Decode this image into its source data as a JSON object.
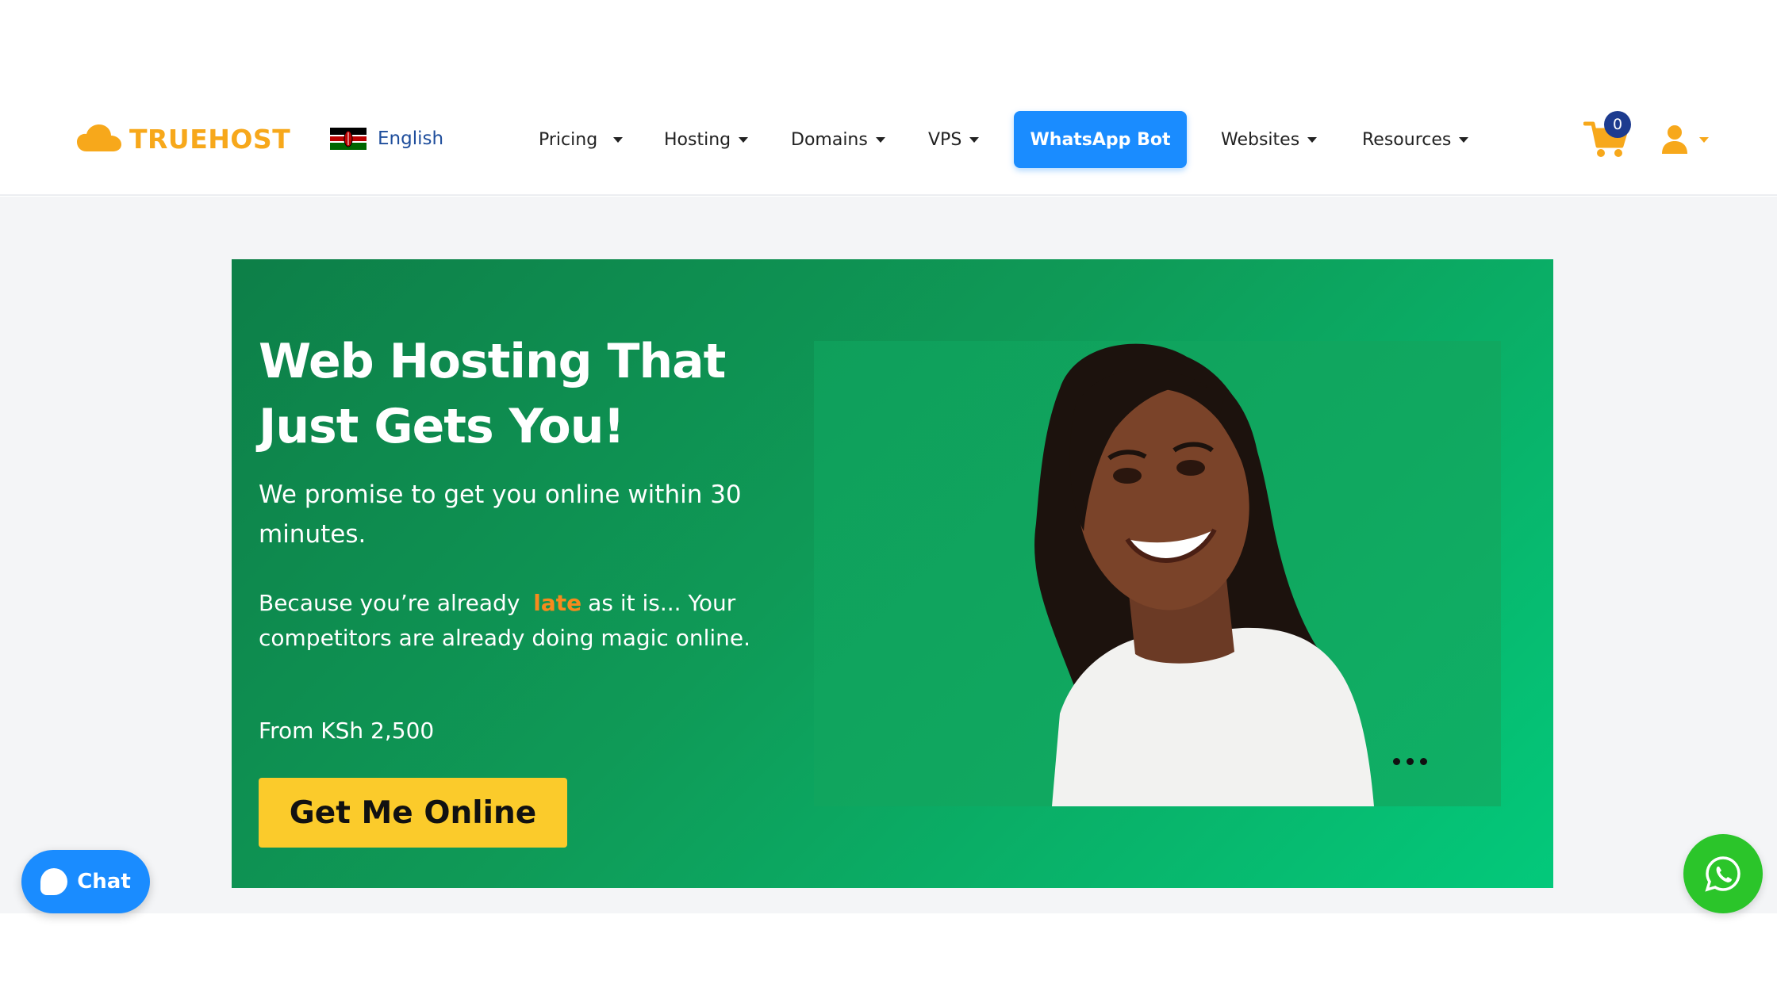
{
  "brand": {
    "name": "TRUEHOST",
    "color": "#f7a81b"
  },
  "language": {
    "label": "English",
    "flag": "kenya-flag"
  },
  "nav": {
    "items": [
      {
        "label": "Pricing",
        "has_dropdown": true
      },
      {
        "label": "Hosting",
        "has_dropdown": true
      },
      {
        "label": "Domains",
        "has_dropdown": true
      },
      {
        "label": "VPS",
        "has_dropdown": true
      },
      {
        "label": "WhatsApp Bot",
        "has_dropdown": false,
        "highlighted": true
      },
      {
        "label": "Websites",
        "has_dropdown": true
      },
      {
        "label": "Resources",
        "has_dropdown": true
      }
    ]
  },
  "cart": {
    "count": "0",
    "icon": "shopping-cart-icon"
  },
  "user": {
    "icon": "user-icon"
  },
  "hero": {
    "title": "Web Hosting That Just Gets You!",
    "subtitle": "We promise to get you online within 30 minutes.",
    "para_before": "Because you’re already",
    "para_highlight": "late",
    "para_after": "as it is... Your competitors are already doing magic online.",
    "price": "From KSh 2,500",
    "cta": "Get Me Online"
  },
  "chat": {
    "label": "Chat"
  },
  "colors": {
    "accent_blue": "#1a8cff",
    "hero_green": "#0f9a57",
    "cta_yellow": "#fbcb2b",
    "highlight_orange": "#f78a1d",
    "whatsapp_green": "#2bc52a"
  }
}
